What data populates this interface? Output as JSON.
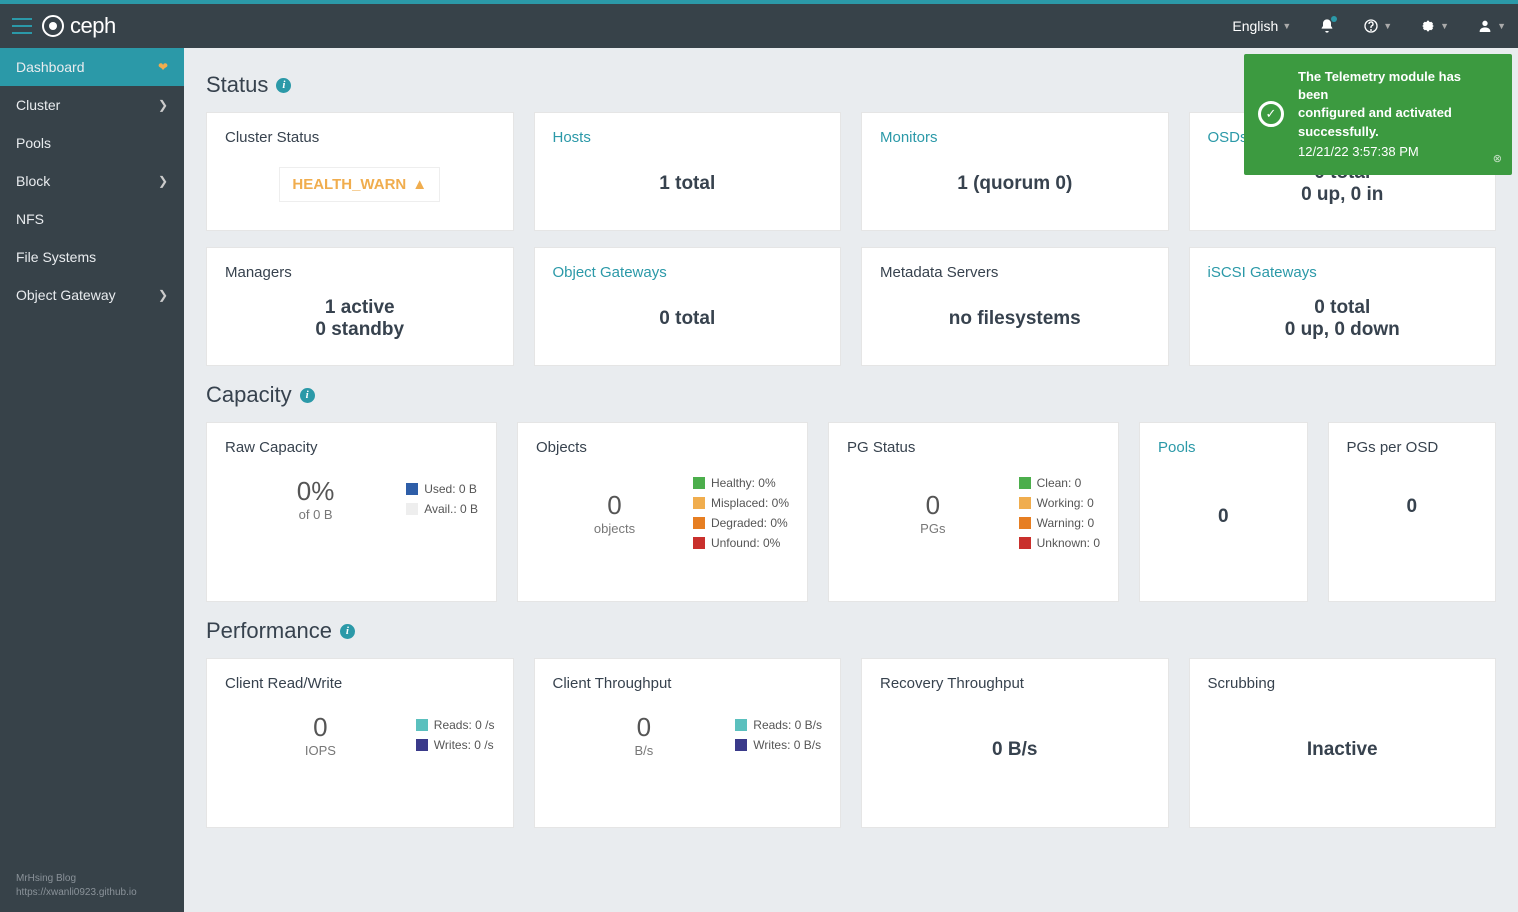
{
  "brand": "ceph",
  "topnav": {
    "language": "English"
  },
  "sidebar": {
    "items": [
      "Dashboard",
      "Cluster",
      "Pools",
      "Block",
      "NFS",
      "File Systems",
      "Object Gateway"
    ],
    "footer_line1": "MrHsing Blog",
    "footer_line2": "https://xwanli0923.github.io"
  },
  "toast": {
    "line1": "The Telemetry module has been",
    "line2": "configured and activated successfully.",
    "time": "12/21/22 3:57:38 PM"
  },
  "sections": {
    "status": "Status",
    "capacity": "Capacity",
    "performance": "Performance"
  },
  "status": {
    "cluster": {
      "title": "Cluster Status",
      "value": "HEALTH_WARN"
    },
    "hosts": {
      "title": "Hosts",
      "value": "1 total"
    },
    "monitors": {
      "title": "Monitors",
      "value": "1 (quorum 0)"
    },
    "osds": {
      "title": "OSDs",
      "line1": "0 total",
      "line2": "0 up, 0 in"
    },
    "managers": {
      "title": "Managers",
      "line1": "1 active",
      "line2": "0 standby"
    },
    "ogw": {
      "title": "Object Gateways",
      "value": "0 total"
    },
    "mds": {
      "title": "Metadata Servers",
      "value": "no filesystems"
    },
    "iscsi": {
      "title": "iSCSI Gateways",
      "line1": "0 total",
      "line2": "0 up, 0 down"
    }
  },
  "capacity": {
    "raw": {
      "title": "Raw Capacity",
      "pct": "0%",
      "sub": "of 0 B",
      "used": "Used: 0 B",
      "avail": "Avail.: 0 B"
    },
    "objects": {
      "title": "Objects",
      "val": "0",
      "sub": "objects",
      "legend": [
        {
          "color": "#4cae4c",
          "label": "Healthy: 0%"
        },
        {
          "color": "#f0ad4e",
          "label": "Misplaced: 0%"
        },
        {
          "color": "#e67e22",
          "label": "Degraded: 0%"
        },
        {
          "color": "#c9302c",
          "label": "Unfound: 0%"
        }
      ]
    },
    "pg": {
      "title": "PG Status",
      "val": "0",
      "sub": "PGs",
      "legend": [
        {
          "color": "#4cae4c",
          "label": "Clean: 0"
        },
        {
          "color": "#f0ad4e",
          "label": "Working: 0"
        },
        {
          "color": "#e67e22",
          "label": "Warning: 0"
        },
        {
          "color": "#c9302c",
          "label": "Unknown: 0"
        }
      ]
    },
    "pools": {
      "title": "Pools",
      "val": "0"
    },
    "pgper": {
      "title": "PGs per OSD",
      "val": "0"
    }
  },
  "perf": {
    "crw": {
      "title": "Client Read/Write",
      "val": "0",
      "sub": "IOPS",
      "legend": [
        {
          "color": "#5bc0be",
          "label": "Reads: 0 /s"
        },
        {
          "color": "#3a3a8a",
          "label": "Writes: 0 /s"
        }
      ]
    },
    "ctp": {
      "title": "Client Throughput",
      "val": "0",
      "sub": "B/s",
      "legend": [
        {
          "color": "#5bc0be",
          "label": "Reads: 0 B/s"
        },
        {
          "color": "#3a3a8a",
          "label": "Writes: 0 B/s"
        }
      ]
    },
    "rtp": {
      "title": "Recovery Throughput",
      "val": "0 B/s"
    },
    "scrub": {
      "title": "Scrubbing",
      "val": "Inactive"
    }
  }
}
